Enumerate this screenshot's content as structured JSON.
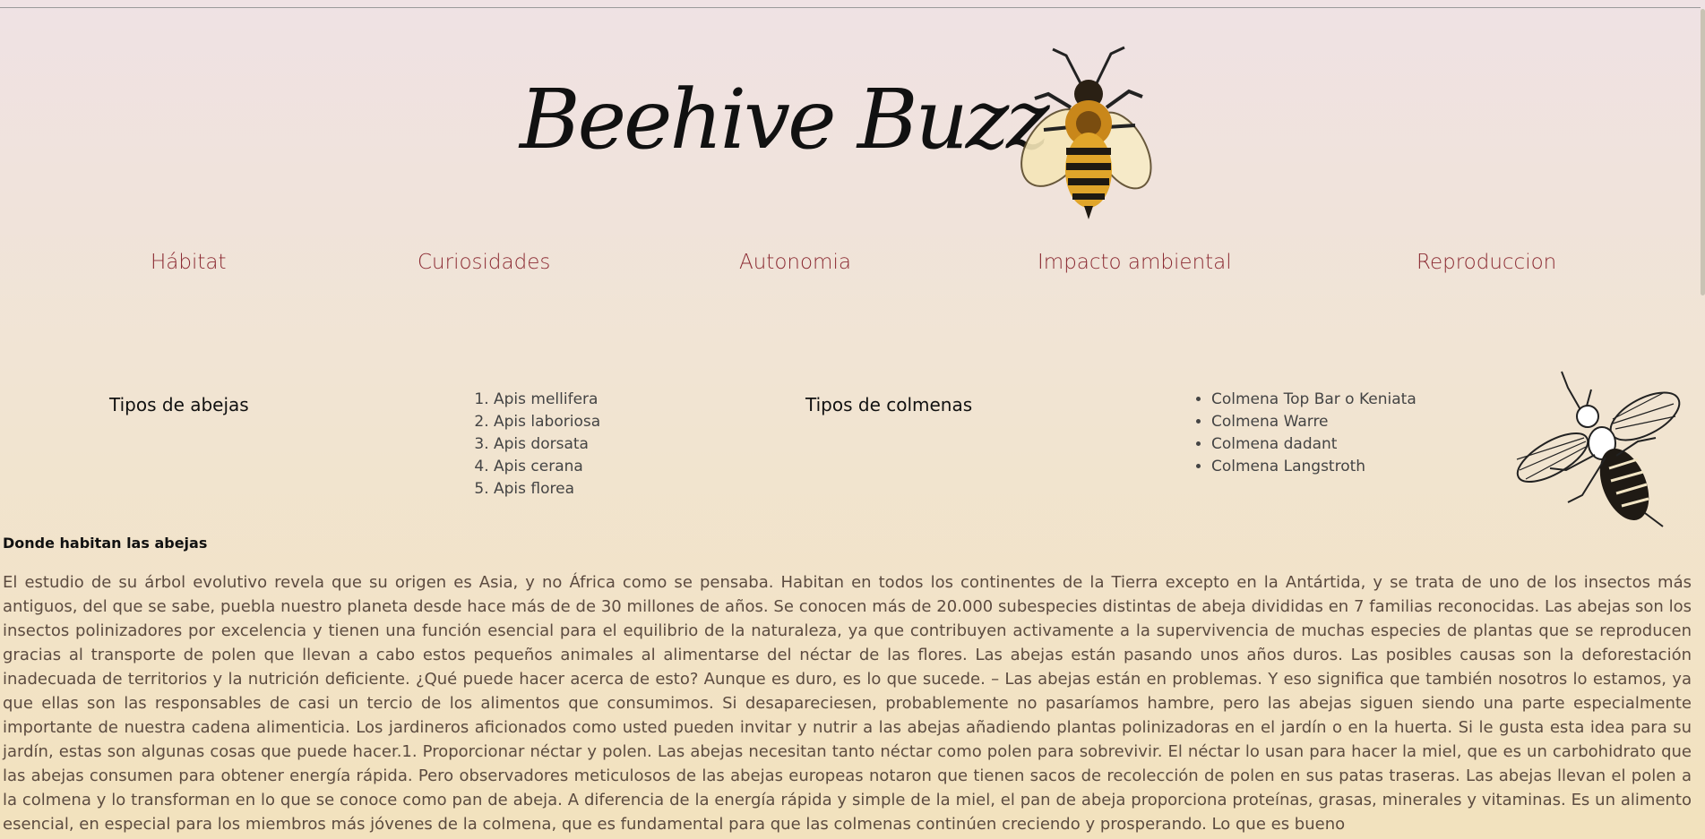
{
  "site": {
    "title": "Beehive Buzz",
    "logo_icon": "bee-icon",
    "side_icon": "bee-outline-icon"
  },
  "nav": {
    "items": [
      {
        "label": "Hábitat"
      },
      {
        "label": "Curiosidades"
      },
      {
        "label": "Autonomia"
      },
      {
        "label": "Impacto ambiental"
      },
      {
        "label": "Reproduccion"
      }
    ]
  },
  "sections": {
    "bees_title": "Tipos de abejas",
    "bees_list": [
      "Apis mellifera",
      "Apis laboriosa",
      "Apis dorsata",
      "Apis cerana",
      "Apis florea"
    ],
    "hives_title": "Tipos de colmenas",
    "hives_list": [
      "Colmena Top Bar o Keniata",
      "Colmena Warre",
      "Colmena dadant",
      "Colmena Langstroth"
    ]
  },
  "article": {
    "heading": "Donde habitan las abejas",
    "body": "El estudio de su árbol evolutivo revela que su origen es Asia, y no África como se pensaba. Habitan en todos los continentes de la Tierra excepto en la Antártida, y se trata de uno de los insectos más antiguos, del que se sabe, puebla nuestro planeta desde hace más de de 30 millones de años. Se conocen más de 20.000 subespecies distintas de abeja divididas en 7 familias reconocidas. Las abejas son los insectos polinizadores por excelencia y tienen una función esencial para el equilibrio de la naturaleza, ya que contribuyen activamente a la supervivencia de muchas especies de plantas que se reproducen gracias al transporte de polen que llevan a cabo estos pequeños animales al alimentarse del néctar de las flores. Las abejas están pasando unos años duros. Las posibles causas son la deforestación inadecuada de territorios y la nutrición deficiente. ¿Qué puede hacer acerca de esto? Aunque es duro, es lo que sucede. – Las abejas están en problemas. Y eso significa que también nosotros lo estamos, ya que ellas son las responsables de casi un tercio de los alimentos que consumimos. Si desapareciesen, probablemente no pasaríamos hambre, pero las abejas siguen siendo una parte especialmente importante de nuestra cadena alimenticia. Los jardineros aficionados como usted pueden invitar y nutrir a las abejas añadiendo plantas polinizadoras en el jardín o en la huerta. Si le gusta esta idea para su jardín, estas son algunas cosas que puede hacer.1. Proporcionar néctar y polen. Las abejas necesitan tanto néctar como polen para sobrevivir. El néctar lo usan para hacer la miel, que es un carbohidrato que las abejas consumen para obtener energía rápida. Pero observadores meticulosos de las abejas europeas notaron que tienen sacos de recolección de polen en sus patas traseras. Las abejas llevan el polen a la colmena y lo transforman en lo que se conoce como pan de abeja. A diferencia de la energía rápida y simple de la miel, el pan de abeja proporciona proteínas, grasas, minerales y vitaminas. Es un alimento esencial, en especial para los miembros más jóvenes de la colmena, que es fundamental para que las colmenas continúen creciendo y prosperando. Lo que es bueno"
  }
}
